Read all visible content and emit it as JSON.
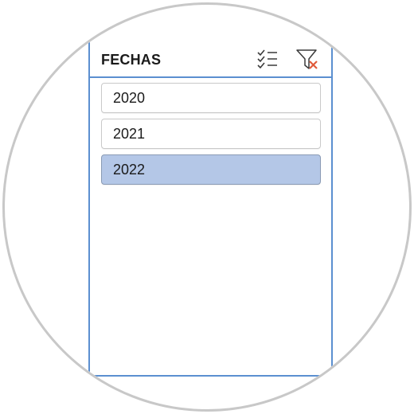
{
  "slicer": {
    "title": "FECHAS",
    "multiselect_icon": "multi-select-icon",
    "clear_filter_icon": "clear-filter-icon",
    "items": [
      {
        "label": "2020",
        "selected": false
      },
      {
        "label": "2021",
        "selected": false
      },
      {
        "label": "2022",
        "selected": true
      }
    ]
  },
  "colors": {
    "border": "#5b8fd0",
    "selected_fill": "#b4c7e7",
    "clear_x": "#e05a3a",
    "frame": "#c8c8c8"
  }
}
